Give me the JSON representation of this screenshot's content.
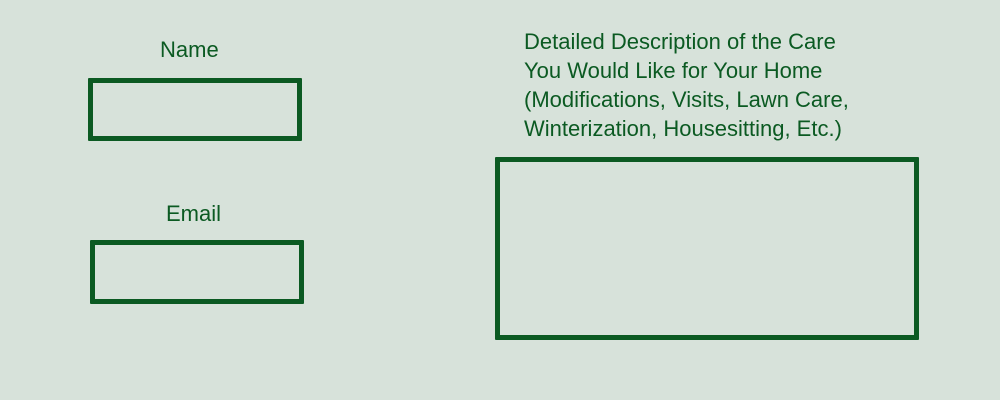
{
  "form": {
    "name": {
      "label": "Name",
      "value": ""
    },
    "email": {
      "label": "Email",
      "value": ""
    },
    "description": {
      "label": "Detailed Description of the Care\nYou Would Like for Your Home\n(Modifications, Visits, Lawn Care,\nWinterization, Housesitting, Etc.)",
      "value": ""
    }
  },
  "colors": {
    "background": "#d7e2da",
    "accent": "#0b5a22"
  }
}
